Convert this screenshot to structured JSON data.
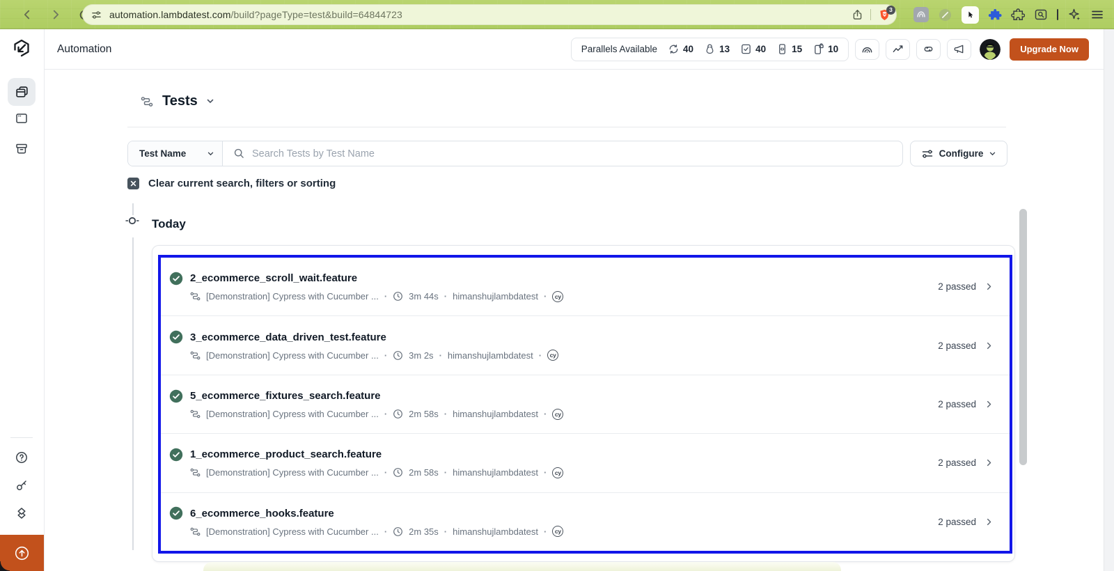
{
  "browser": {
    "url_domain": "automation.lambdatest.com",
    "url_path": "/build?pageType=test&build=64844723",
    "shield_badge": "3"
  },
  "header": {
    "app_title": "Automation",
    "parallels_label": "Parallels Available",
    "stats": [
      {
        "icon": "web-parallel-icon",
        "value": "40"
      },
      {
        "icon": "linux-icon",
        "value": "13"
      },
      {
        "icon": "test-checklist-icon",
        "value": "40"
      },
      {
        "icon": "mobile-code-icon",
        "value": "15"
      },
      {
        "icon": "mobile-lock-icon",
        "value": "10"
      }
    ],
    "upgrade_button": "Upgrade Now"
  },
  "toolbar": {
    "title": "Tests",
    "filter_dropdown": "Test Name",
    "search_placeholder": "Search Tests by Test Name",
    "configure_button": "Configure",
    "clear_filters": "Clear current search, filters or sorting"
  },
  "timeline": {
    "group_label": "Today"
  },
  "tests": [
    {
      "name": "2_ecommerce_scroll_wait.feature",
      "build": "[Demonstration] Cypress with Cucumber ...",
      "duration": "3m 44s",
      "user": "himanshujlambdatest",
      "framework": "cy",
      "status": "2 passed"
    },
    {
      "name": "3_ecommerce_data_driven_test.feature",
      "build": "[Demonstration] Cypress with Cucumber ...",
      "duration": "3m 2s",
      "user": "himanshujlambdatest",
      "framework": "cy",
      "status": "2 passed"
    },
    {
      "name": "5_ecommerce_fixtures_search.feature",
      "build": "[Demonstration] Cypress with Cucumber ...",
      "duration": "2m 58s",
      "user": "himanshujlambdatest",
      "framework": "cy",
      "status": "2 passed"
    },
    {
      "name": "1_ecommerce_product_search.feature",
      "build": "[Demonstration] Cypress with Cucumber ...",
      "duration": "2m 58s",
      "user": "himanshujlambdatest",
      "framework": "cy",
      "status": "2 passed"
    },
    {
      "name": "6_ecommerce_hooks.feature",
      "build": "[Demonstration] Cypress with Cucumber ...",
      "duration": "2m 35s",
      "user": "himanshujlambdatest",
      "framework": "cy",
      "status": "2 passed"
    }
  ],
  "colors": {
    "chrome_green": "#b9d46f",
    "upgrade_orange": "#c2511c",
    "highlight_blue": "#1216e9",
    "passed_green": "#41705c",
    "brave_orange": "#fb542b"
  }
}
